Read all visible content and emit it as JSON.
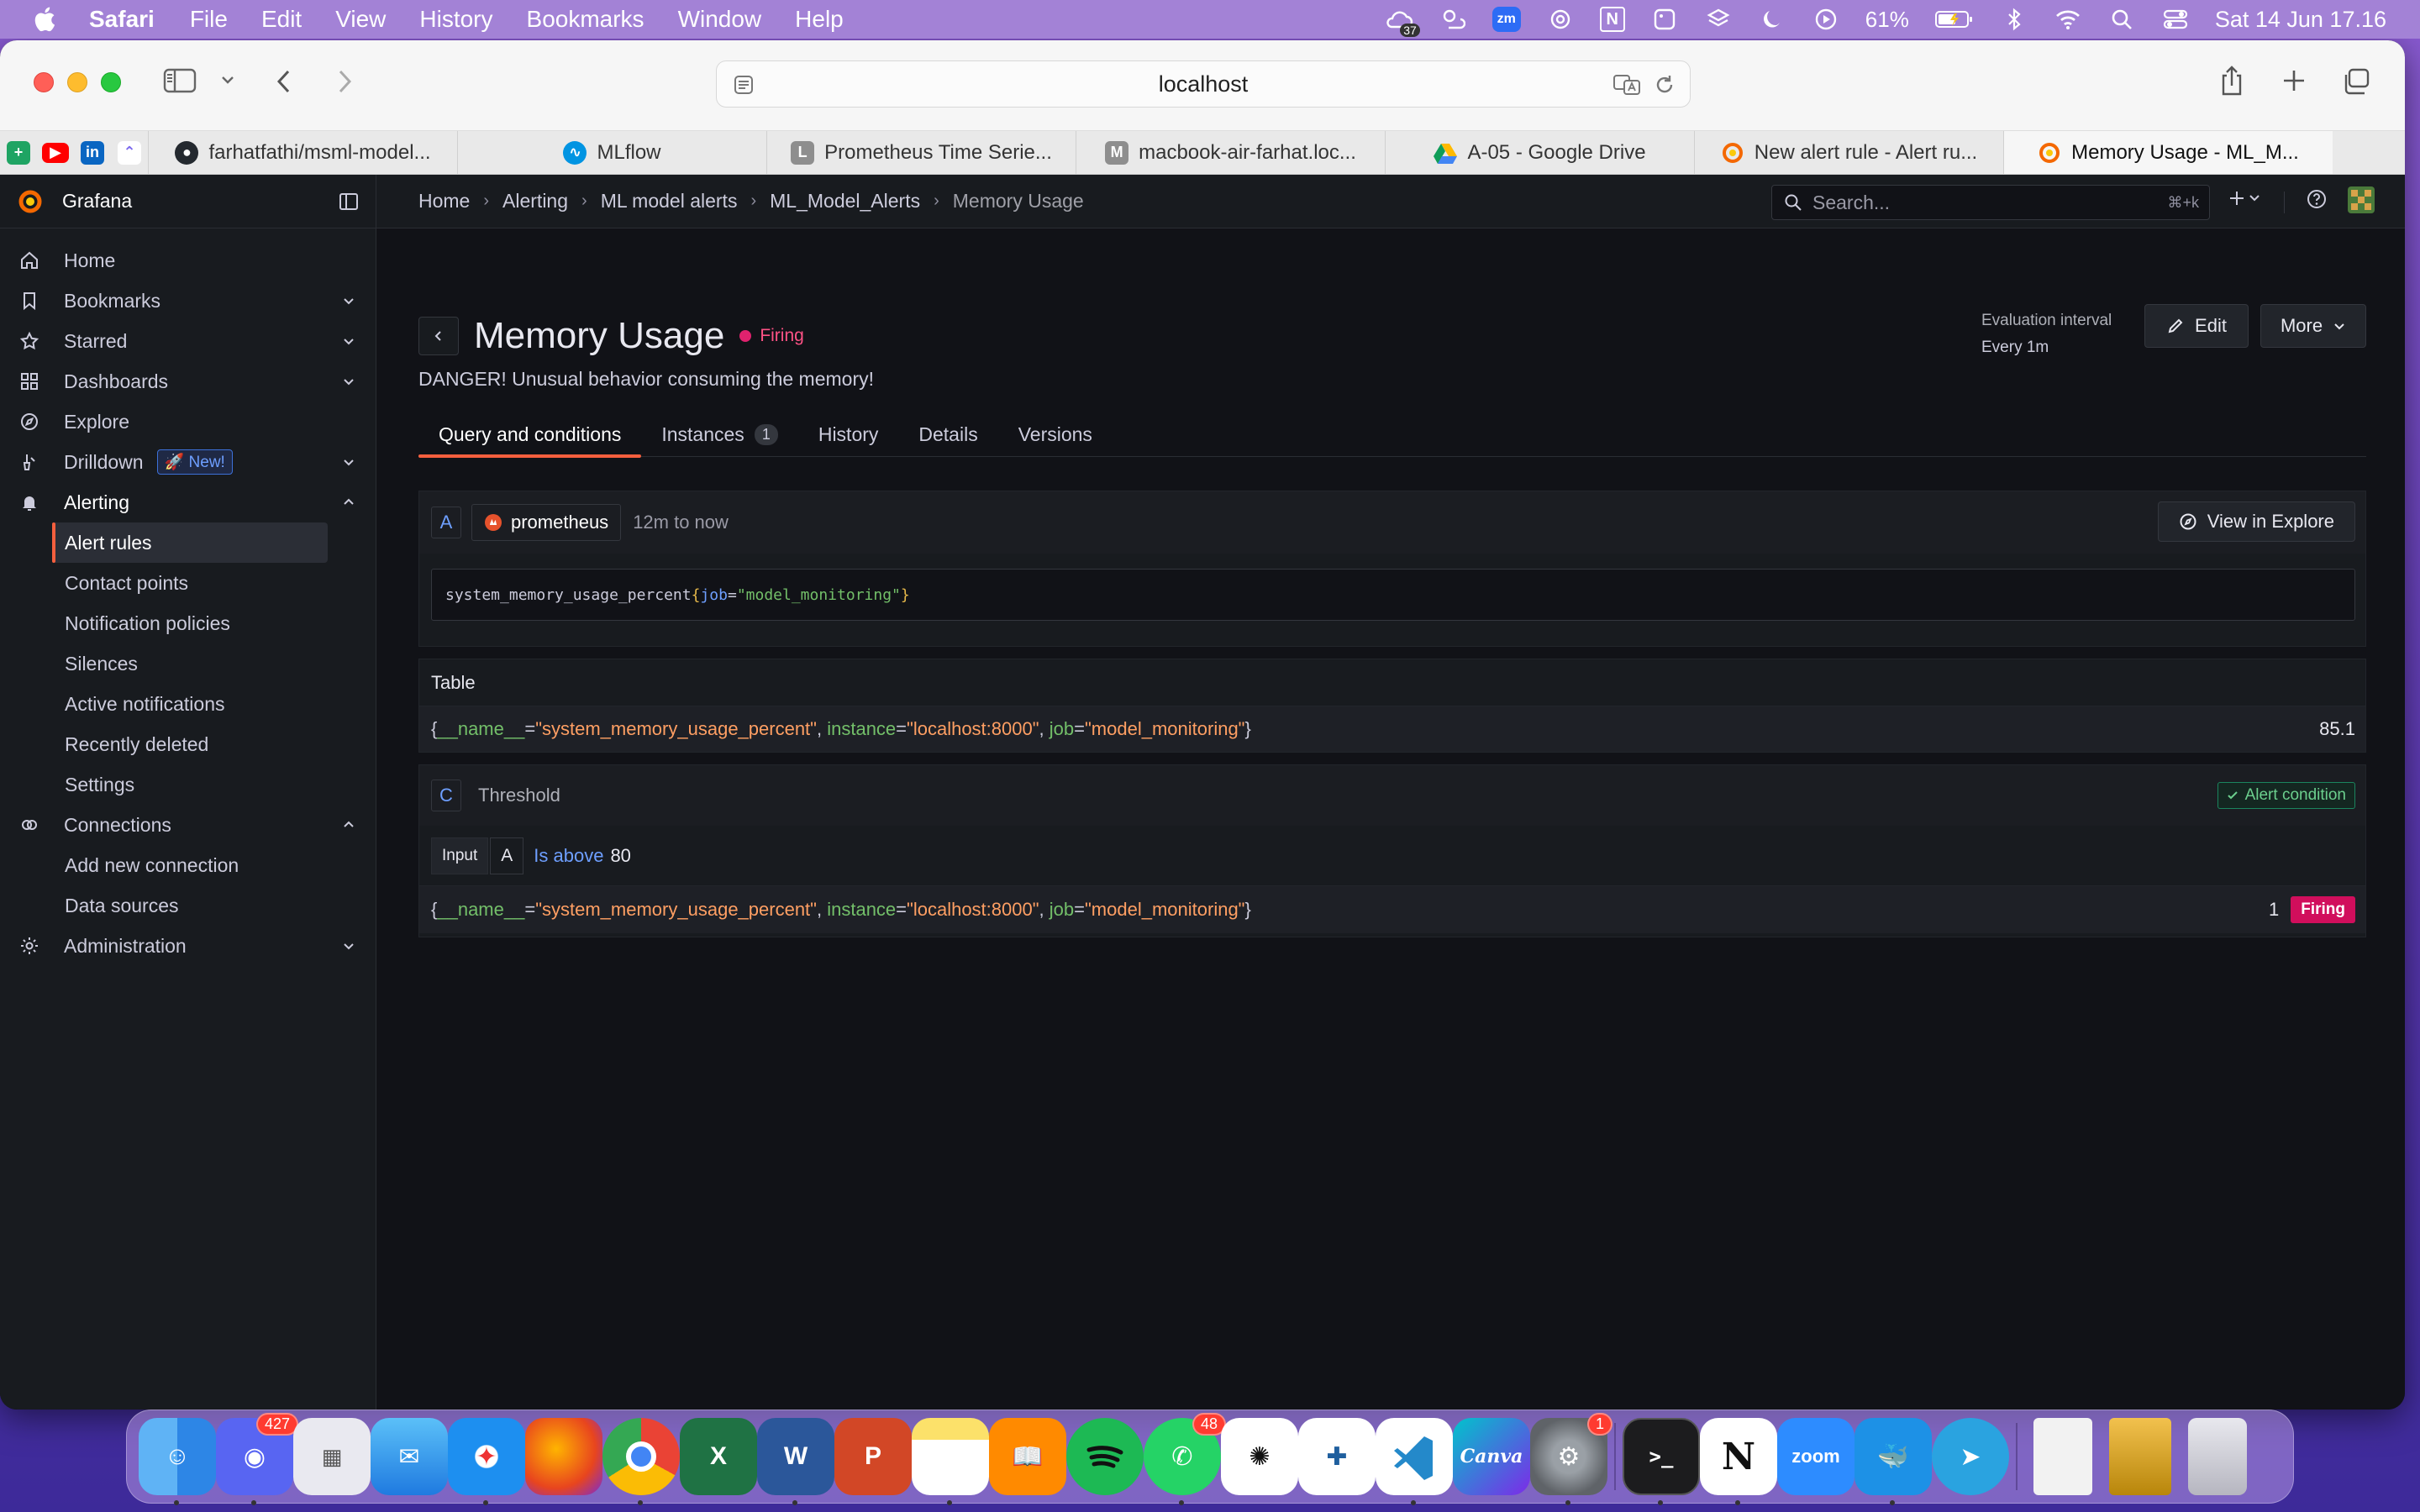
{
  "menubar": {
    "app_name": "Safari",
    "menus": [
      "File",
      "Edit",
      "View",
      "History",
      "Bookmarks",
      "Window",
      "Help"
    ],
    "notification_count": "37",
    "zoom_label": "zm",
    "notion_label": "N",
    "battery": "61%",
    "clock": "Sat 14 Jun  17.16"
  },
  "browser": {
    "address": "localhost",
    "tabs": [
      {
        "label": "farhatfathi/msml-model...",
        "icon": "github-icon"
      },
      {
        "label": "MLflow",
        "icon": "mlflow-icon"
      },
      {
        "label": "Prometheus Time Serie...",
        "icon": "letter-l-icon",
        "letter": "L"
      },
      {
        "label": "macbook-air-farhat.loc...",
        "icon": "letter-m-icon",
        "letter": "M"
      },
      {
        "label": "A-05 - Google Drive",
        "icon": "google-drive-icon"
      },
      {
        "label": "New alert rule - Alert ru...",
        "icon": "grafana-icon"
      },
      {
        "label": "Memory Usage - ML_M...",
        "icon": "grafana-icon",
        "active": true
      }
    ]
  },
  "grafana": {
    "brand": "Grafana",
    "search_placeholder": "Search...",
    "search_shortcut": "⌘+k",
    "breadcrumb": [
      "Home",
      "Alerting",
      "ML model alerts",
      "ML_Model_Alerts",
      "Memory Usage"
    ],
    "sidebar": {
      "items": [
        {
          "label": "Home",
          "icon": "home-icon"
        },
        {
          "label": "Bookmarks",
          "icon": "bookmark-icon"
        },
        {
          "label": "Starred",
          "icon": "star-icon"
        },
        {
          "label": "Dashboards",
          "icon": "dashboards-icon"
        },
        {
          "label": "Explore",
          "icon": "compass-icon"
        },
        {
          "label": "Drilldown",
          "icon": "drilldown-icon",
          "badge": "New!"
        },
        {
          "label": "Alerting",
          "icon": "bell-icon"
        }
      ],
      "alerting_children": [
        "Alert rules",
        "Contact points",
        "Notification policies",
        "Silences",
        "Active notifications",
        "Recently deleted",
        "Settings"
      ],
      "connections": {
        "label": "Connections",
        "icon": "connections-icon"
      },
      "connections_children": [
        "Add new connection",
        "Data sources"
      ],
      "administration": {
        "label": "Administration",
        "icon": "gear-icon"
      }
    },
    "rule": {
      "title": "Memory Usage",
      "state": "Firing",
      "description": "DANGER! Unusual behavior consuming the memory!",
      "eval_label": "Evaluation interval",
      "eval_value": "Every 1m",
      "edit_label": "Edit",
      "more_label": "More"
    },
    "tabs": [
      {
        "label": "Query and conditions",
        "active": true
      },
      {
        "label": "Instances",
        "count": "1"
      },
      {
        "label": "History"
      },
      {
        "label": "Details"
      },
      {
        "label": "Versions"
      }
    ],
    "query": {
      "ref": "A",
      "datasource": "prometheus",
      "range": "12m to now",
      "explore_label": "View in Explore",
      "expr_metric": "system_memory_usage_percent",
      "expr_open": "{",
      "expr_key": "job",
      "expr_eq": "=",
      "expr_value": "\"model_monitoring\"",
      "expr_close": "}"
    },
    "table": {
      "header": "Table",
      "value": "85.1"
    },
    "series_labels": {
      "open": "{",
      "k1": "__name__",
      "v1": "\"system_memory_usage_percent\"",
      "k2": "instance",
      "v2": "\"localhost:8000\"",
      "k3": "job",
      "v3": "\"model_monitoring\"",
      "close": "}",
      "sep": ", ",
      "eq": "="
    },
    "threshold": {
      "ref": "C",
      "name": "Threshold",
      "alert_condition": "Alert condition",
      "input_label": "Input",
      "input_ref": "A",
      "operator": "Is above",
      "value": "80",
      "result_value": "1",
      "result_state": "Firing"
    }
  },
  "dock": {
    "discord_badge": "427",
    "whatsapp_badge": "48",
    "settings_badge": "1",
    "apps": [
      "finder-icon",
      "discord-icon",
      "launchpad-icon",
      "mail-icon",
      "safari-icon",
      "firefox-icon",
      "chrome-icon",
      "excel-icon",
      "word-icon",
      "powerpoint-icon",
      "notes-icon",
      "books-icon",
      "spotify-icon",
      "whatsapp-icon",
      "chatgpt-icon",
      "tableau-icon",
      "vscode-icon",
      "canva-icon",
      "system-settings-icon",
      "terminal-icon",
      "notion-icon",
      "zoom-icon",
      "docker-icon",
      "telegram-icon",
      "documents-icon",
      "archive-icon",
      "trash-icon"
    ],
    "labels": {
      "canva": "Canva",
      "zoom": "zoom",
      "excel": "X",
      "word": "W",
      "powerpoint": "P",
      "notion": "N",
      "terminal": ">_"
    }
  }
}
